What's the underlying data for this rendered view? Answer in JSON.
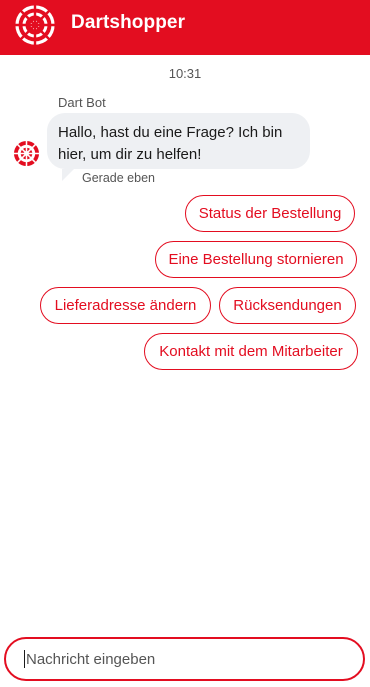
{
  "header": {
    "brand": "Dartshopper",
    "logo_icon": "dartboard-logo-icon",
    "accent": "#e30d20"
  },
  "chat": {
    "time": "10:31",
    "sender": "Dart Bot",
    "message": "Hallo, hast du eine Frage? Ich bin hier, um dir zu helfen!",
    "status": "Gerade eben",
    "avatar_icon": "dartboard-avatar-icon"
  },
  "quick_replies": [
    "Status der Bestellung",
    "Eine Bestellung stornieren",
    "Lieferadresse ändern",
    "Rücksendungen",
    "Kontakt mit dem Mitarbeiter"
  ],
  "composer": {
    "placeholder": "Nachricht eingeben"
  }
}
